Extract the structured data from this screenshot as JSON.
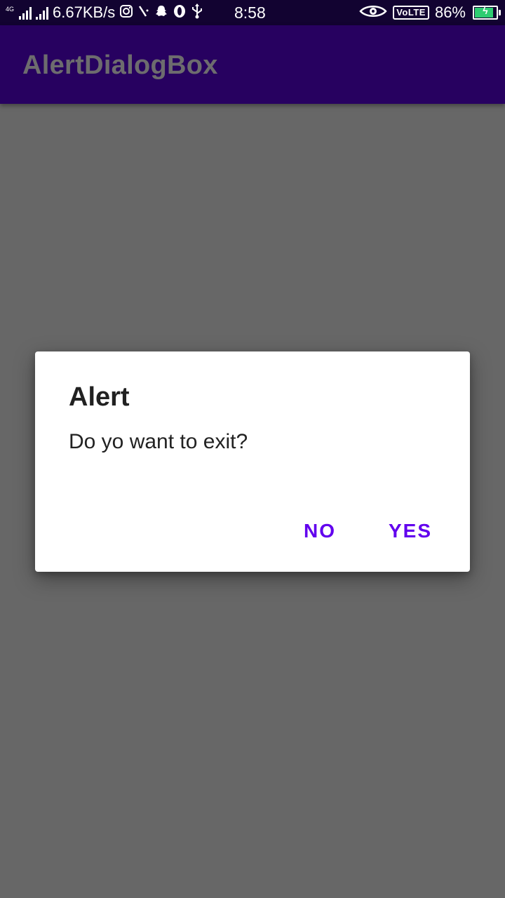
{
  "status_bar": {
    "network_label": "4G",
    "speed": "6.67KB/s",
    "time": "8:58",
    "volte": "VoLTE",
    "battery_percent": "86%",
    "battery_level": 0.86,
    "icons": [
      "signal-icon",
      "signal-icon",
      "instagram-icon",
      "slash-icon",
      "snapchat-icon",
      "opera-icon",
      "usb-icon",
      "eye-icon",
      "battery-icon"
    ]
  },
  "app_bar": {
    "title": "AlertDialogBox"
  },
  "dialog": {
    "title": "Alert",
    "message": "Do yo want to exit?",
    "negative_label": "NO",
    "positive_label": "YES"
  },
  "colors": {
    "status_bar": "#120331",
    "app_bar": "#270160",
    "scrim": "#676767",
    "accent": "#6200ee",
    "battery_fill": "#2ecc71"
  }
}
